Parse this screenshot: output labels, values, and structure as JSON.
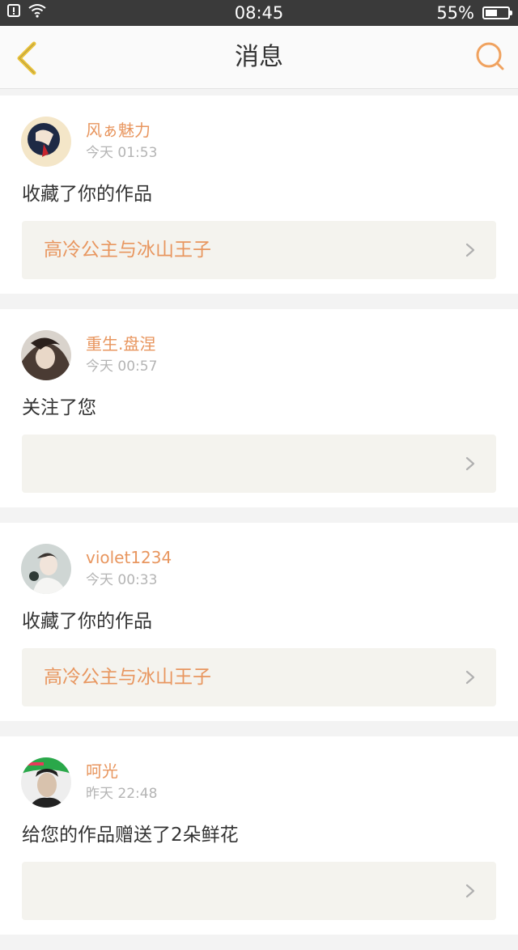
{
  "status_bar": {
    "time": "08:45",
    "battery_text": "55%",
    "battery_level": 0.55,
    "icons": [
      "notification-icon",
      "wifi-icon",
      "battery-icon"
    ]
  },
  "nav": {
    "title": "消息",
    "back_icon": "back-chevron-icon",
    "search_icon": "search-icon"
  },
  "colors": {
    "accent": "#e8965f",
    "back_icon": "#e9c23a",
    "search_icon": "#f0a25f",
    "card_box": "#f4f3ee",
    "status_bar": "#3a3a3a"
  },
  "messages": [
    {
      "username": "风ぁ魅力",
      "time": "今天 01:53",
      "action": "收藏了你的作品",
      "work_title": "高冷公主与冰山王子"
    },
    {
      "username": "重生.盘涅",
      "time": "今天 00:57",
      "action": "关注了您",
      "work_title": ""
    },
    {
      "username": "violet1234",
      "time": "今天 00:33",
      "action": "收藏了你的作品",
      "work_title": "高冷公主与冰山王子"
    },
    {
      "username": "呵光",
      "time": "昨天 22:48",
      "action": "给您的作品赠送了2朵鲜花",
      "work_title": ""
    }
  ]
}
